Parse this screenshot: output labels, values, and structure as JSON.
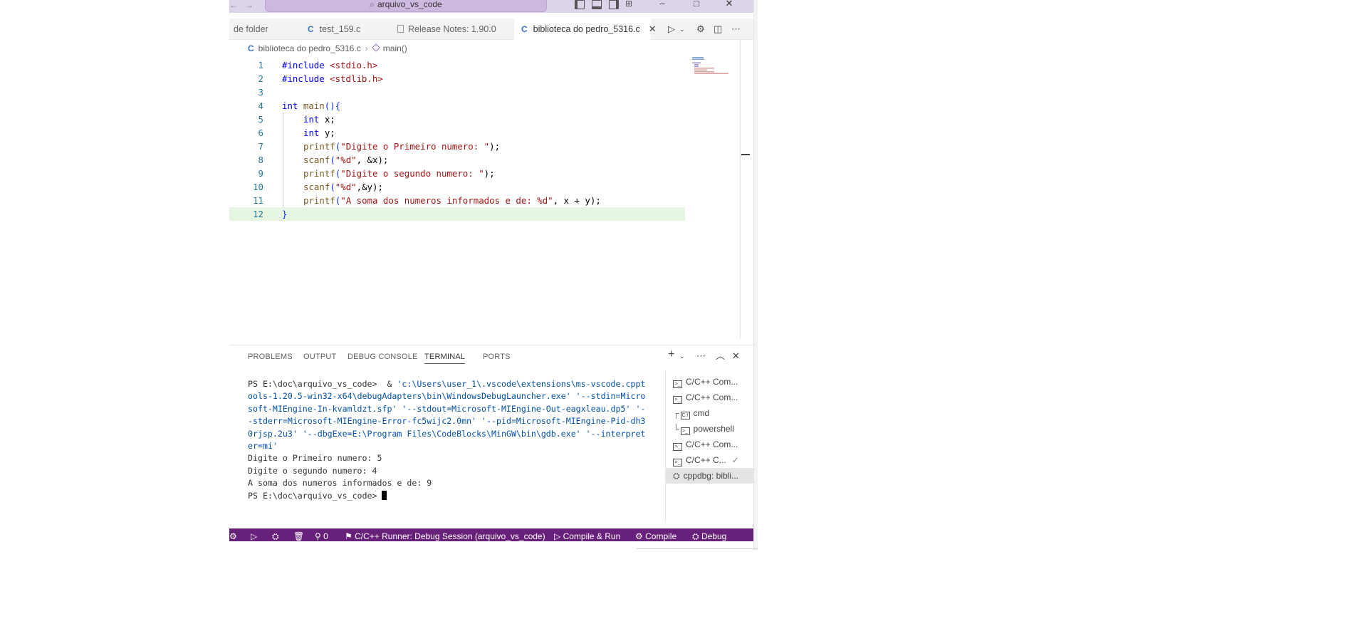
{
  "window": {
    "search_text": "arquivo_vs_code",
    "title_icons": [
      "toggle-primary-sidebar-icon",
      "toggle-panel-icon",
      "toggle-secondary-sidebar-icon",
      "customize-layout-icon"
    ],
    "controls": {
      "minimize": "–",
      "maximize": "□",
      "close": "✕"
    }
  },
  "tabs": [
    {
      "label": "de folder",
      "active": false
    },
    {
      "label": "test_159.c",
      "active": false,
      "icon": "C"
    },
    {
      "label": "Release Notes: 1.90.0",
      "active": false
    },
    {
      "label": "biblioteca do pedro_5316.c",
      "active": true,
      "icon": "C"
    }
  ],
  "breadcrumb": {
    "file": "biblioteca do pedro_5316.c",
    "symbol": "main()",
    "file_icon": "C"
  },
  "editor": {
    "lines": [
      {
        "n": "1"
      },
      {
        "n": "2"
      },
      {
        "n": "3"
      },
      {
        "n": "4"
      },
      {
        "n": "5"
      },
      {
        "n": "6"
      },
      {
        "n": "7"
      },
      {
        "n": "8"
      },
      {
        "n": "9"
      },
      {
        "n": "10"
      },
      {
        "n": "11"
      },
      {
        "n": "12"
      }
    ],
    "code": {
      "l1a": "#include",
      "l1b": "<stdio.h>",
      "l2a": "#include",
      "l2b": "<stdlib.h>",
      "l4a": "int",
      "l4b": "main",
      "l4c": "(){",
      "l5a": "int",
      "l5b": " x;",
      "l6a": "int",
      "l6b": " y;",
      "l7a": "printf",
      "l7b": "(",
      "l7c": "\"Digite o Primeiro numero: \"",
      "l7d": ");",
      "l8a": "scanf",
      "l8b": "(",
      "l8c": "\"%d\"",
      "l8d": ", &x);",
      "l9a": "printf",
      "l9b": "(",
      "l9c": "\"Digite o segundo numero: \"",
      "l9d": ");",
      "l10a": "scanf",
      "l10b": "(",
      "l10c": "\"%d\"",
      "l10d": ",&y);",
      "l11a": "printf",
      "l11b": "(",
      "l11c": "\"A soma dos numeros informados e de: %d\"",
      "l11d": ", x + y);",
      "l12a": "}"
    }
  },
  "panel": {
    "tabs": [
      "PROBLEMS",
      "OUTPUT",
      "DEBUG CONSOLE",
      "TERMINAL",
      "PORTS"
    ],
    "active_tab": "TERMINAL",
    "terminal": {
      "prompt1": "PS E:\\doc\\arquivo_vs_code>  & ",
      "cmd_l1": "'c:\\Users\\user_1\\.vscode\\extensions\\ms-vscode.cppt",
      "cmd_l2": "ools-1.20.5-win32-x64\\debugAdapters\\bin\\WindowsDebugLauncher.exe' '--stdin=Micro",
      "cmd_l3": "soft-MIEngine-In-kvamldzt.sfp' '--stdout=Microsoft-MIEngine-Out-eagxleau.dp5' '-",
      "cmd_l4": "-stderr=Microsoft-MIEngine-Error-fc5wijc2.0mn' '--pid=Microsoft-MIEngine-Pid-dh3",
      "cmd_l5": "0rjsp.2u3' '--dbgExe=E:\\Program Files\\CodeBlocks\\MinGW\\bin\\gdb.exe' '--interpret",
      "cmd_l6": "er=mi'",
      "out1": "Digite o Primeiro numero: 5",
      "out2": "Digite o segundo numero: 4",
      "out3": "A soma dos numeros informados e de: 9",
      "prompt2": "PS E:\\doc\\arquivo_vs_code> "
    },
    "terminals": [
      {
        "label": "C/C++ Com...",
        "icon": "terminal-icon"
      },
      {
        "label": "C/C++ Com...",
        "icon": "terminal-icon"
      },
      {
        "label": "cmd",
        "icon": "cmd-icon",
        "tree": "┌"
      },
      {
        "label": "powershell",
        "icon": "terminal-icon",
        "tree": "└"
      },
      {
        "label": "C/C++ Com...",
        "icon": "terminal-icon"
      },
      {
        "label": "C/C++ C...",
        "icon": "terminal-icon",
        "check": "✓"
      },
      {
        "label": "cppdbg: bibli...",
        "icon": "debug-icon",
        "selected": true
      }
    ]
  },
  "statusbar": {
    "remote_count": "0",
    "runner": "C/C++ Runner: Debug Session (arquivo_vs_code)",
    "compile_run": "Compile & Run",
    "compile": "Compile",
    "debug": "Debug",
    "background": "#68217a"
  }
}
